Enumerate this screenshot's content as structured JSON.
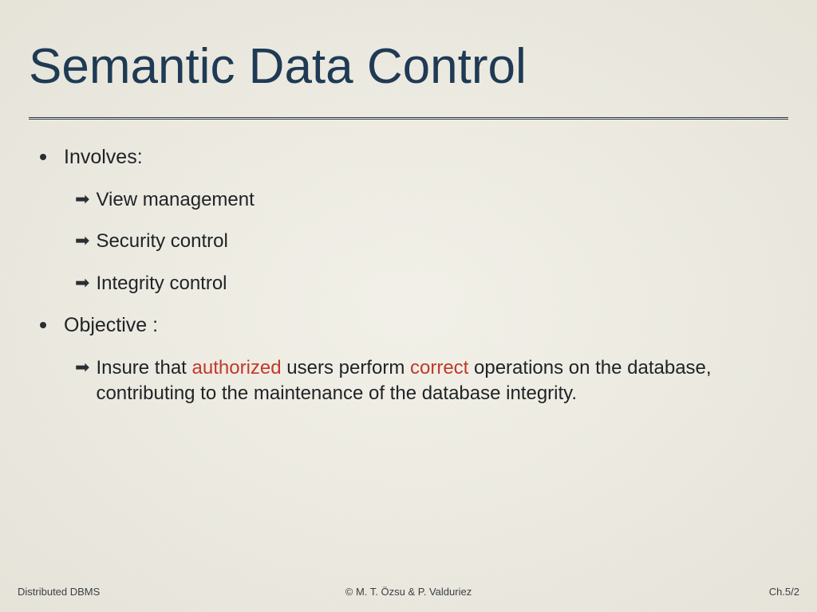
{
  "title": "Semantic Data Control",
  "bullets": [
    {
      "label": "Involves:",
      "items": [
        {
          "text": "View management"
        },
        {
          "text": "Security control"
        },
        {
          "text": "Integrity control"
        }
      ]
    },
    {
      "label": "Objective :",
      "items": [
        {
          "prefix": "Insure that ",
          "hl1": "authorized",
          "mid": " users perform ",
          "hl2": "correct",
          "suffix": " operations on the database, contributing to the maintenance of the database integrity."
        }
      ]
    }
  ],
  "footer": {
    "left": "Distributed DBMS",
    "center": "© M. T. Özsu & P. Valduriez",
    "right": "Ch.5/2"
  }
}
